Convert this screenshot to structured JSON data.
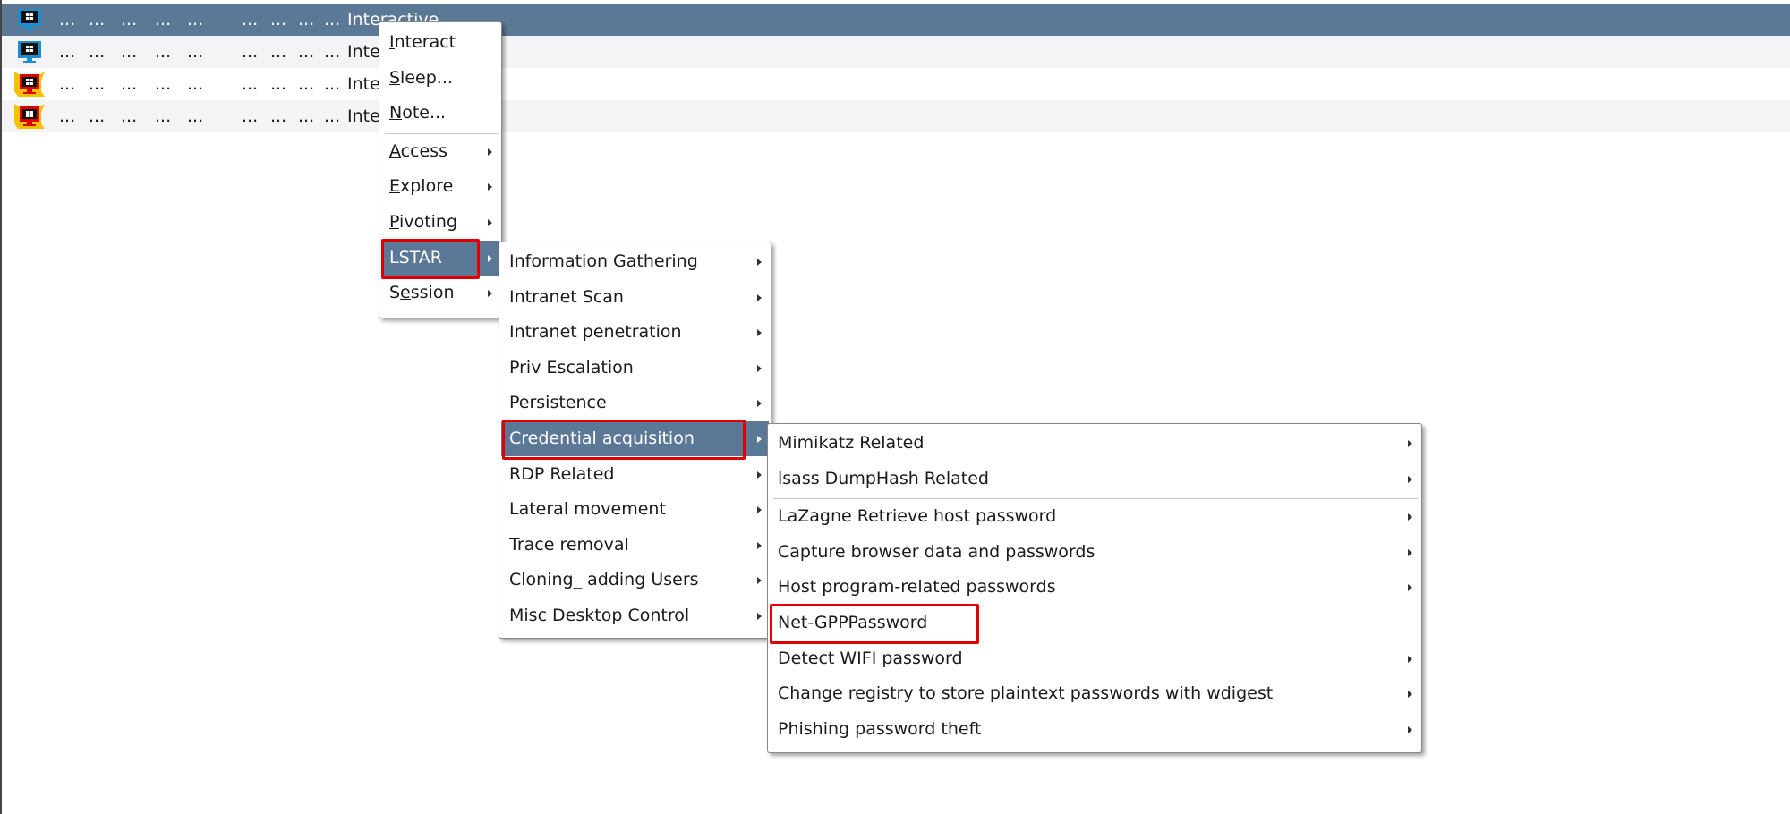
{
  "colors": {
    "selection": "#5b7896",
    "highlight_box": "#e00000"
  },
  "sessions": [
    {
      "icon": "windows-monitor-icon",
      "cols": [
        "...",
        "...",
        "...",
        "...",
        "...",
        "...",
        "...",
        "...",
        "..."
      ],
      "status": "Interactive",
      "selected": true
    },
    {
      "icon": "windows-monitor-icon",
      "cols": [
        "...",
        "...",
        "...",
        "...",
        "...",
        "...",
        "...",
        "...",
        "..."
      ],
      "status": "Interactive"
    },
    {
      "icon": "windows-monitor-admin-icon",
      "cols": [
        "...",
        "...",
        "...",
        "...",
        "...",
        "...",
        "...",
        "...",
        "..."
      ],
      "status": "Interactive"
    },
    {
      "icon": "windows-monitor-admin-icon",
      "cols": [
        "...",
        "...",
        "...",
        "...",
        "...",
        "...",
        "...",
        "...",
        "..."
      ],
      "status": "Interactive"
    }
  ],
  "menu1": {
    "items": [
      {
        "label": "Interact",
        "mnemonic": 0
      },
      {
        "label": "Sleep...",
        "mnemonic": 0
      },
      {
        "label": "Note...",
        "mnemonic": 0,
        "separator_after": true
      },
      {
        "label": "Access",
        "mnemonic": 0,
        "submenu": true
      },
      {
        "label": "Explore",
        "mnemonic": 0,
        "submenu": true
      },
      {
        "label": "Pivoting",
        "mnemonic": 0,
        "submenu": true
      },
      {
        "label": "LSTAR",
        "submenu": true,
        "active": true
      },
      {
        "label": "Session",
        "mnemonic": 1,
        "submenu": true
      }
    ]
  },
  "menu2": {
    "items": [
      {
        "label": "Information Gathering",
        "submenu": true
      },
      {
        "label": "Intranet Scan",
        "submenu": true
      },
      {
        "label": "Intranet penetration",
        "submenu": true
      },
      {
        "label": "Priv Escalation",
        "submenu": true
      },
      {
        "label": "Persistence",
        "submenu": true
      },
      {
        "label": "Credential acquisition",
        "submenu": true,
        "active": true
      },
      {
        "label": "RDP Related",
        "submenu": true
      },
      {
        "label": "Lateral movement",
        "submenu": true
      },
      {
        "label": "Trace removal",
        "submenu": true
      },
      {
        "label": "Cloning_ adding Users",
        "submenu": true
      },
      {
        "label": "Misc Desktop Control",
        "submenu": true
      }
    ]
  },
  "menu3": {
    "items": [
      {
        "label": "Mimikatz Related",
        "submenu": true
      },
      {
        "label": "lsass DumpHash Related",
        "submenu": true,
        "separator_after": true
      },
      {
        "label": "LaZagne Retrieve host password",
        "submenu": true
      },
      {
        "label": "Capture browser data and passwords",
        "submenu": true
      },
      {
        "label": "Host program-related passwords",
        "submenu": true
      },
      {
        "label": "Net-GPPPassword",
        "submenu": false,
        "boxed": true
      },
      {
        "label": "Detect WIFI password",
        "submenu": true
      },
      {
        "label": "Change registry to store plaintext passwords with wdigest",
        "submenu": true
      },
      {
        "label": "Phishing password theft",
        "submenu": true
      }
    ]
  }
}
